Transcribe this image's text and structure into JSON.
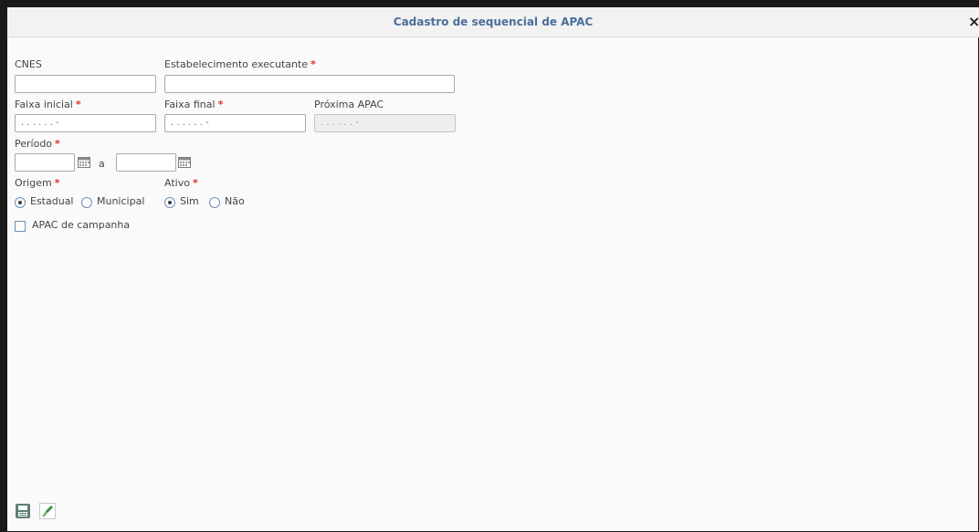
{
  "dialog": {
    "title": "Cadastro de sequencial de APAC",
    "close_label": "×"
  },
  "form": {
    "cnes": {
      "label": "CNES",
      "value": ""
    },
    "estabelecimento": {
      "label": "Estabelecimento executante",
      "required_mark": "*",
      "value": ""
    },
    "faixa_inicial": {
      "label": "Faixa inicial",
      "required_mark": "*",
      "mask": ". . . . .  .  -"
    },
    "faixa_final": {
      "label": "Faixa final",
      "required_mark": "*",
      "mask": ". . . . .  .  -"
    },
    "proxima_apac": {
      "label": "Próxima APAC",
      "mask": ". . . . .  .  -"
    },
    "periodo": {
      "label": "Período",
      "required_mark": "*",
      "separator": "a",
      "start": "",
      "end": ""
    },
    "origem": {
      "label": "Origem",
      "required_mark": "*",
      "options": [
        "Estadual",
        "Municipal"
      ],
      "selected": "Estadual"
    },
    "ativo": {
      "label": "Ativo",
      "required_mark": "*",
      "options": [
        "Sim",
        "Não"
      ],
      "selected": "Sim"
    },
    "apac_campanha": {
      "label": "APAC de campanha",
      "checked": false
    }
  },
  "icons": {
    "save": "save-icon",
    "clear": "clear-icon",
    "calendar": "calendar-icon"
  },
  "colors": {
    "title": "#4a6f99",
    "required": "#e0312a",
    "radio_border": "#6b8fb7"
  }
}
